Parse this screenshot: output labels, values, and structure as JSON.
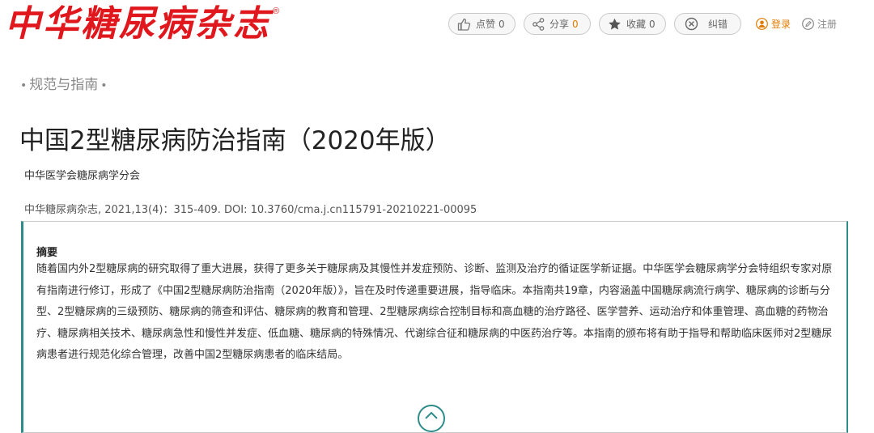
{
  "header": {
    "logo_text": "中华糖尿病杂志",
    "logo_reg": "®",
    "like": {
      "label": "点赞",
      "count": "0"
    },
    "share": {
      "label": "分享",
      "count": "0"
    },
    "favorite": {
      "label": "收藏",
      "count": "0"
    },
    "report": {
      "label": "纠错"
    },
    "login_label": "登录",
    "register_label": "注册"
  },
  "breadcrumb": {
    "section": "规范与指南",
    "dot": "•"
  },
  "article": {
    "title": "中国2型糖尿病防治指南（2020年版）",
    "author": "中华医学会糖尿病学分会",
    "citation": "中华糖尿病杂志, 2021,13(4)：315-409. DOI: 10.3760/cma.j.cn115791-20210221-00095"
  },
  "abstract": {
    "heading": "摘要",
    "text": "随着国内外2型糖尿病的研究取得了重大进展，获得了更多关于糖尿病及其慢性并发症预防、诊断、监测及治疗的循证医学新证据。中华医学会糖尿病学分会特组织专家对原有指南进行修订，形成了《中国2型糖尿病防治指南（2020年版）》，旨在及时传递重要进展，指导临床。本指南共19章，内容涵盖中国糖尿病流行病学、糖尿病的诊断与分型、2型糖尿病的三级预防、糖尿病的筛查和评估、糖尿病的教育和管理、2型糖尿病综合控制目标和高血糖的治疗路径、医学营养、运动治疗和体重管理、高血糖的药物治疗、糖尿病相关技术、糖尿病急性和慢性并发症、低血糖、糖尿病的特殊情况、代谢综合征和糖尿病的中医药治疗等。本指南的颁布将有助于指导和帮助临床医师对2型糖尿病患者进行规范化综合管理，改善中国2型糖尿病患者的临床结局。"
  },
  "icons": [
    "thumbs-up-icon",
    "share-icon",
    "star-icon",
    "close-circle-icon",
    "user-icon",
    "edit-icon",
    "chevron-up-icon"
  ],
  "colors": {
    "brand_red": "#e0171c",
    "accent_teal": "#2e8c8a",
    "highlight_orange": "#e07b00"
  }
}
